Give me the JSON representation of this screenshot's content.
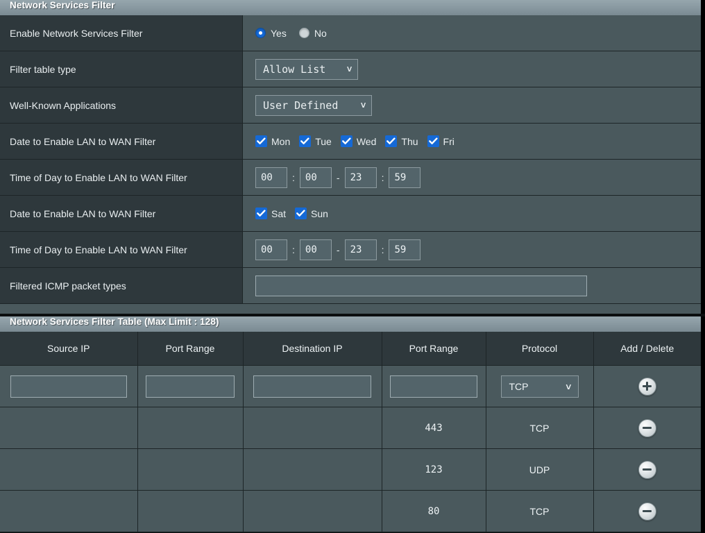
{
  "settings_panel": {
    "title": "Network Services Filter",
    "rows": {
      "enable": {
        "label": "Enable Network Services Filter",
        "options": [
          {
            "label": "Yes",
            "selected": true
          },
          {
            "label": "No",
            "selected": false
          }
        ]
      },
      "filter_table_type": {
        "label": "Filter table type",
        "value": "Allow List",
        "chevron": "∨"
      },
      "well_known_apps": {
        "label": "Well-Known Applications",
        "value": "User Defined",
        "chevron": "∨"
      },
      "date_weekday": {
        "label": "Date to Enable LAN to WAN Filter",
        "days": [
          {
            "label": "Mon",
            "checked": true
          },
          {
            "label": "Tue",
            "checked": true
          },
          {
            "label": "Wed",
            "checked": true
          },
          {
            "label": "Thu",
            "checked": true
          },
          {
            "label": "Fri",
            "checked": true
          }
        ]
      },
      "time_weekday": {
        "label": "Time of Day to Enable LAN to WAN Filter",
        "start_hour": "00",
        "start_min": "00",
        "end_hour": "23",
        "end_min": "59",
        "colon": ":",
        "dash": "-"
      },
      "date_weekend": {
        "label": "Date to Enable LAN to WAN Filter",
        "days": [
          {
            "label": "Sat",
            "checked": true
          },
          {
            "label": "Sun",
            "checked": true
          }
        ]
      },
      "time_weekend": {
        "label": "Time of Day to Enable LAN to WAN Filter",
        "start_hour": "00",
        "start_min": "00",
        "end_hour": "23",
        "end_min": "59",
        "colon": ":",
        "dash": "-"
      },
      "icmp": {
        "label": "Filtered ICMP packet types",
        "value": "",
        "placeholder": ""
      }
    }
  },
  "table_panel": {
    "title": "Network Services Filter Table (Max Limit : 128)",
    "columns": [
      "Source IP",
      "Port Range",
      "Destination IP",
      "Port Range",
      "Protocol",
      "Add / Delete"
    ],
    "input_row": {
      "source_ip": "",
      "source_port": "",
      "dest_ip": "",
      "dest_port": "",
      "protocol": "TCP",
      "chevron": "∨",
      "action": "add"
    },
    "rows": [
      {
        "source_ip": "",
        "source_port": "",
        "dest_ip": "",
        "dest_port": "443",
        "protocol": "TCP",
        "action": "delete"
      },
      {
        "source_ip": "",
        "source_port": "",
        "dest_ip": "",
        "dest_port": "123",
        "protocol": "UDP",
        "action": "delete"
      },
      {
        "source_ip": "",
        "source_port": "",
        "dest_ip": "",
        "dest_port": "80",
        "protocol": "TCP",
        "action": "delete"
      }
    ]
  },
  "colors": {
    "accent_blue": "#1569d6",
    "label_bg": "#2e383c",
    "value_bg": "#4a595d",
    "titlebar_top": "#96a6ad",
    "titlebar_bottom": "#7a8a92",
    "border": "#1d2527",
    "text": "#eef3f5"
  }
}
